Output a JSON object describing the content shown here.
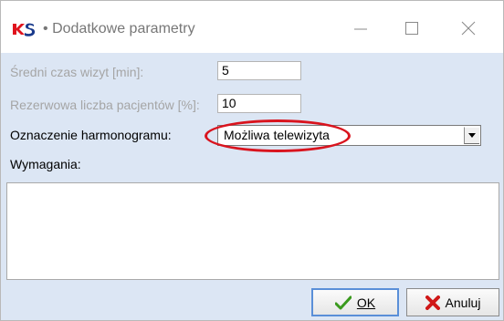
{
  "window": {
    "title": "Dodatkowe parametry",
    "title_separator": "•",
    "icons": [
      "app-logo-icon",
      "minimize-icon",
      "maximize-icon",
      "close-icon"
    ]
  },
  "form": {
    "avg_visit_time": {
      "label": "Średni czas wizyt [min]:",
      "value": "5",
      "enabled": false
    },
    "reserve_patients": {
      "label": "Rezerwowa liczba pacjentów [%]:",
      "value": "10",
      "enabled": false
    },
    "schedule_marking": {
      "label": "Oznaczenie harmonogramu:",
      "selected": "Możliwa telewizyta",
      "enabled": true
    },
    "requirements": {
      "label": "Wymagania:",
      "value": ""
    }
  },
  "buttons": {
    "ok": {
      "label": "OK",
      "icon": "checkmark-icon"
    },
    "cancel": {
      "label": "Anuluj",
      "icon": "x-mark-icon"
    }
  },
  "colors": {
    "client_bg": "#dce6f4",
    "highlight": "#d9141e",
    "ok_icon": "#3a9a1e",
    "cancel_icon": "#d01818",
    "logo_red": "#e0141e",
    "logo_blue": "#1a3a8c"
  }
}
